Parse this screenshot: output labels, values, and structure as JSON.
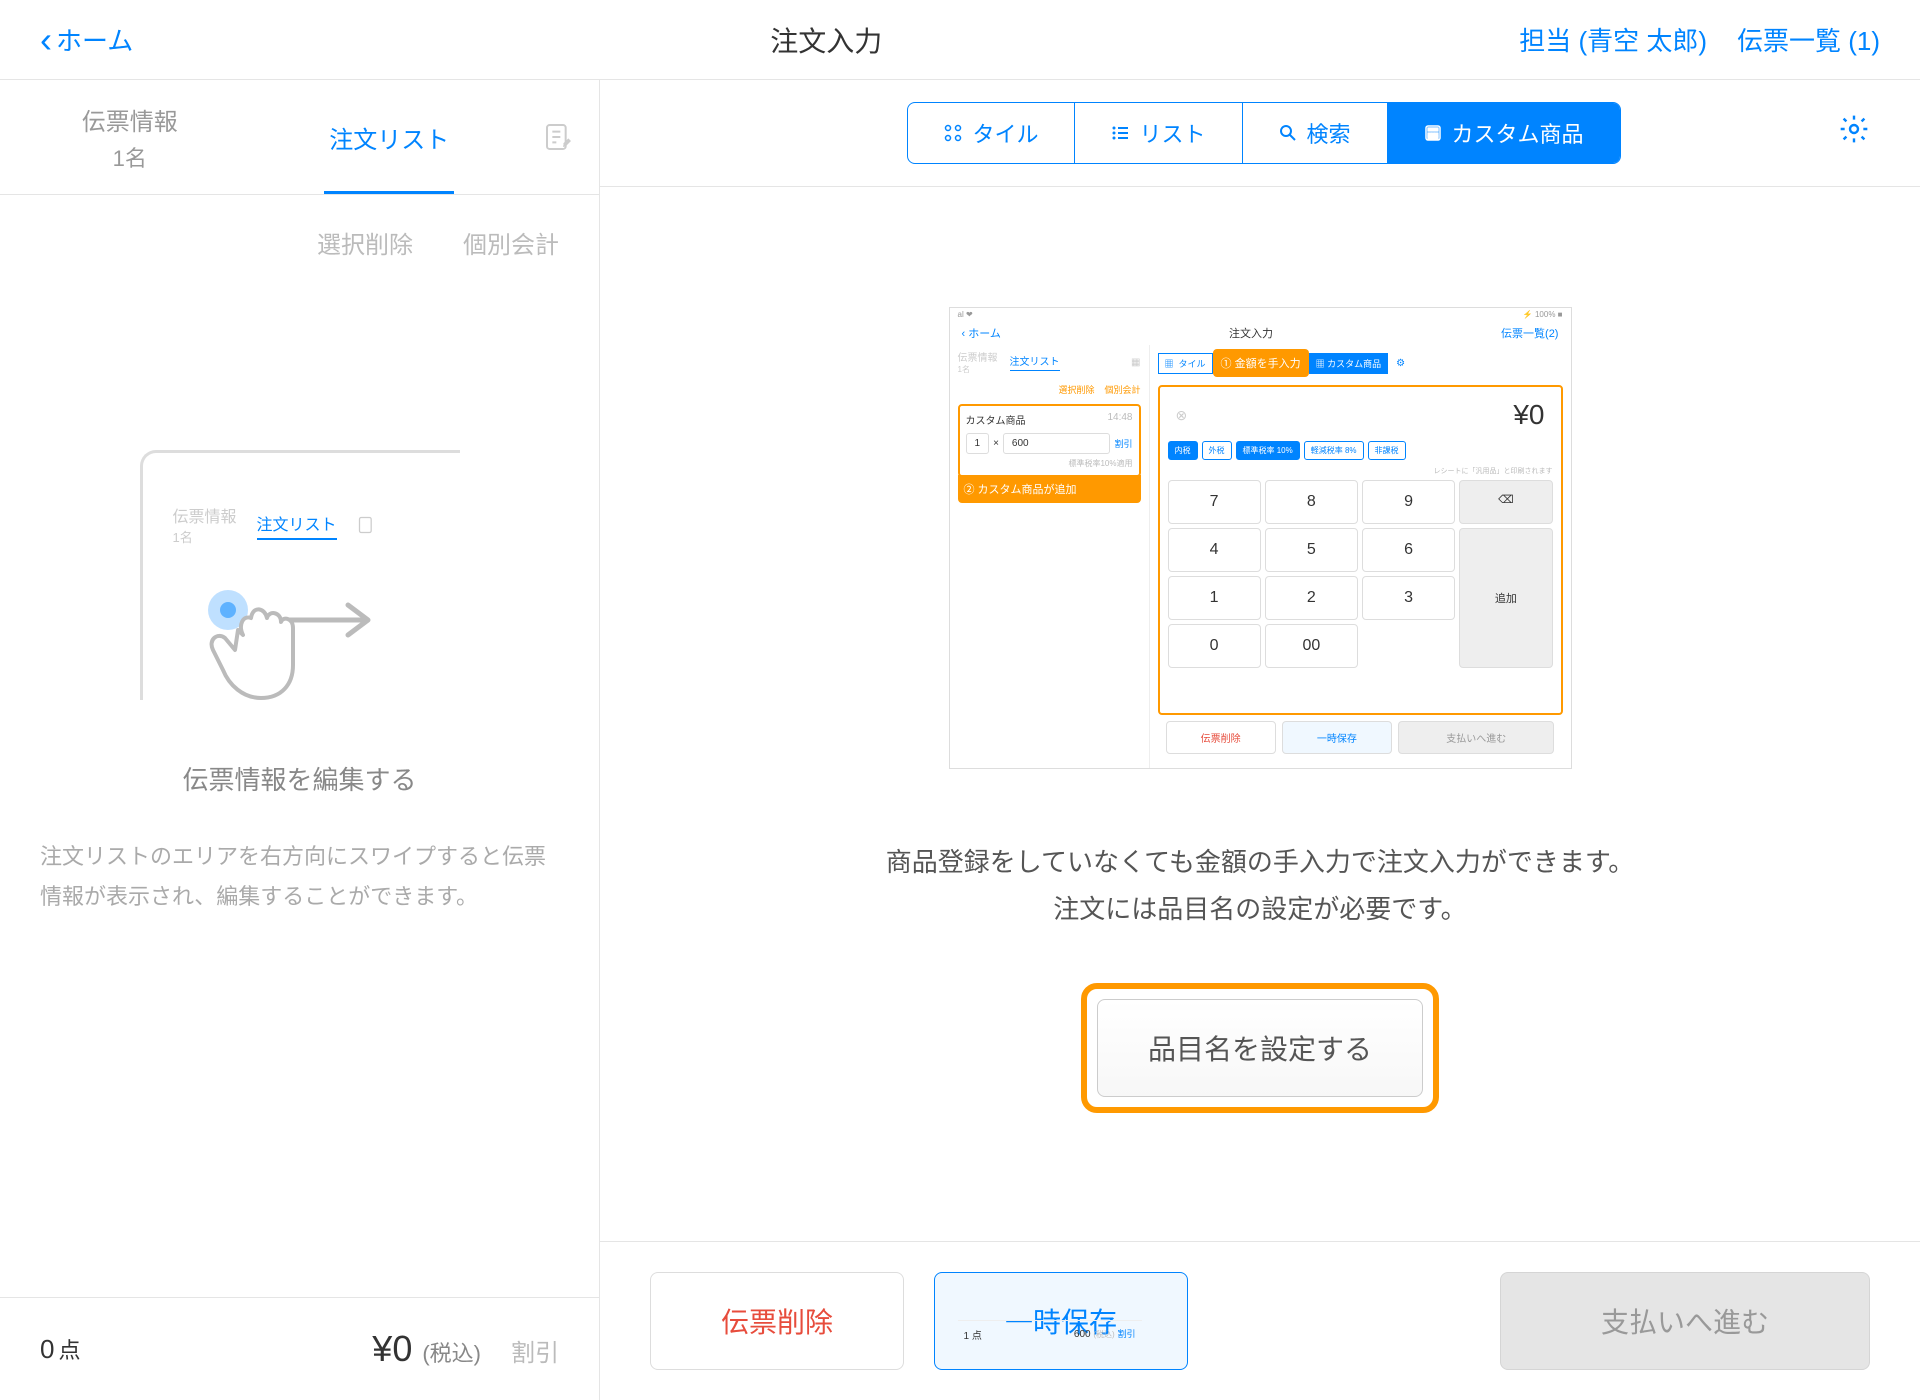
{
  "header": {
    "back": "ホーム",
    "title": "注文入力",
    "person_label": "担当 (青空 太郎)",
    "slip_list_label": "伝票一覧 (1)"
  },
  "sidebar": {
    "tabs": {
      "slip": {
        "label": "伝票情報",
        "sub": "1名"
      },
      "order": {
        "label": "注文リスト"
      }
    },
    "actions": {
      "delete": "選択削除",
      "individual": "個別会計"
    },
    "illus_tabs": {
      "slip": "伝票情報",
      "sub": "1名",
      "order": "注文リスト"
    },
    "heading": "伝票情報を編集する",
    "description": "注文リストのエリアを右方向にスワイプすると伝票情報が表示され、編集することができます。",
    "footer": {
      "points": "0",
      "points_unit": "点",
      "amount": "¥0",
      "tax": "(税込)",
      "discount": "割引"
    }
  },
  "content": {
    "segments": {
      "tile": "タイル",
      "list": "リスト",
      "search": "検索",
      "custom": "カスタム商品"
    },
    "instruction_line1": "商品登録をしていなくても金額の手入力で注文入力ができます。",
    "instruction_line2": "注文には品目名の設定が必要です。",
    "set_name_btn": "品目名を設定する"
  },
  "screenshot": {
    "status_left": "al ❤",
    "status_right": "⚡ 100% ■",
    "back": "ホーム",
    "title": "注文入力",
    "slip_list": "伝票一覧(2)",
    "left": {
      "tab1": "伝票情報",
      "tab1_sub": "1名",
      "tab2": "注文リスト",
      "act1": "選択削除",
      "act2": "個別会計",
      "custom_title": "カスタム商品",
      "time": "14:48",
      "qty": "1",
      "times": "×",
      "price": "600",
      "discount": "割引",
      "tax_note": "標準税率10%適用",
      "callout": "② カスタム商品が追加"
    },
    "right": {
      "seg_tile": "タイル",
      "callout": "① 金額を手入力",
      "seg_custom": "カスタム商品",
      "amount": "¥0",
      "btns": {
        "b1": "内税",
        "b2": "外税",
        "b3": "標準税率 10%",
        "b4": "軽減税率 8%",
        "b5": "非課税"
      },
      "note": "レシートに「汎用品」と印刷されます",
      "keypad": [
        "7",
        "8",
        "9",
        "⌫",
        "4",
        "5",
        "6",
        "1",
        "2",
        "3",
        "0",
        "00"
      ],
      "add_btn": "追加"
    },
    "footer": {
      "points": "1",
      "unit": "点",
      "total": "600",
      "tax": "(税込)",
      "discount": "割引",
      "delete": "伝票削除",
      "save": "一時保存",
      "pay": "支払いへ進む"
    }
  },
  "footer": {
    "delete": "伝票削除",
    "save": "一時保存",
    "pay": "支払いへ進む"
  }
}
